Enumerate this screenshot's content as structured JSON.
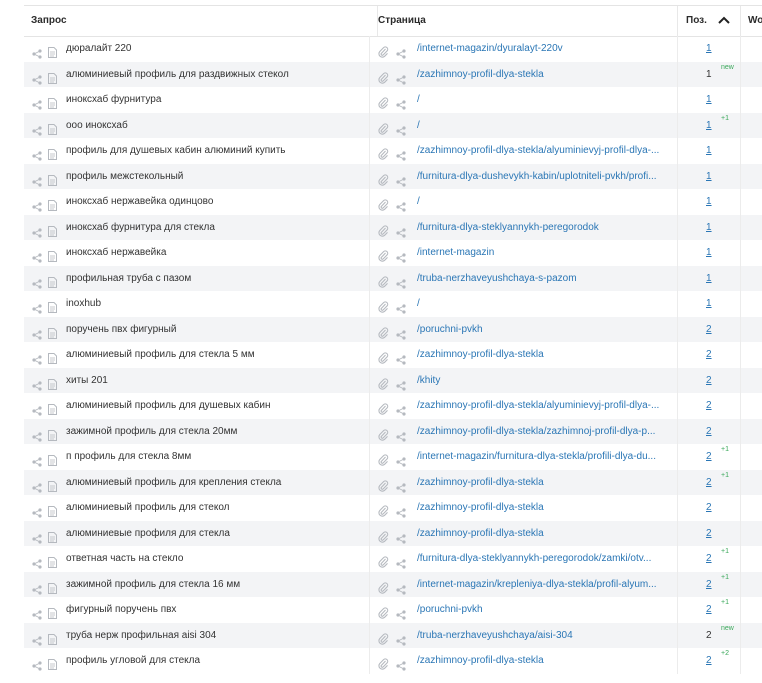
{
  "header": {
    "query": "Запрос",
    "page": "Страница",
    "pos": "Поз.",
    "wo": "Wo"
  },
  "rows": [
    {
      "query": "дюралайт 220",
      "url": "/internet-magazin/dyuralayt-220v",
      "pos": "1",
      "linked": true,
      "badge": ""
    },
    {
      "query": "алюминиевый профиль для раздвижных стекол",
      "url": "/zazhimnoy-profil-dlya-stekla",
      "pos": "1",
      "linked": false,
      "badge": "new"
    },
    {
      "query": "инокcхаб фурнитура",
      "url": "/",
      "pos": "1",
      "linked": true,
      "badge": ""
    },
    {
      "query": "ооо инокcхаб",
      "url": "/",
      "pos": "1",
      "linked": true,
      "badge": "+1"
    },
    {
      "query": "профиль для душевых кабин алюминий купить",
      "url": "/zazhimnoy-profil-dlya-stekla/alyuminievyj-profil-dlya-...",
      "pos": "1",
      "linked": true,
      "badge": ""
    },
    {
      "query": "профиль межстекольный",
      "url": "/furnitura-dlya-dushevykh-kabin/uplotniteli-pvkh/profi...",
      "pos": "1",
      "linked": true,
      "badge": ""
    },
    {
      "query": "инокcхаб нержавейка одинцово",
      "url": "/",
      "pos": "1",
      "linked": true,
      "badge": ""
    },
    {
      "query": "инокcхаб фурнитура для стекла",
      "url": "/furnitura-dlya-steklyannykh-peregorodok",
      "pos": "1",
      "linked": true,
      "badge": ""
    },
    {
      "query": "инокcхаб нержавейка",
      "url": "/internet-magazin",
      "pos": "1",
      "linked": true,
      "badge": ""
    },
    {
      "query": "профильная труба с пазом",
      "url": "/truba-nerzhaveyushchaya-s-pazom",
      "pos": "1",
      "linked": true,
      "badge": ""
    },
    {
      "query": "inoxhub",
      "url": "/",
      "pos": "1",
      "linked": true,
      "badge": ""
    },
    {
      "query": "поручень пвх фигурный",
      "url": "/poruchni-pvkh",
      "pos": "2",
      "linked": true,
      "badge": ""
    },
    {
      "query": "алюминиевый профиль для стекла 5 мм",
      "url": "/zazhimnoy-profil-dlya-stekla",
      "pos": "2",
      "linked": true,
      "badge": ""
    },
    {
      "query": "хиты 201",
      "url": "/khity",
      "pos": "2",
      "linked": true,
      "badge": ""
    },
    {
      "query": "алюминиевый профиль для душевых кабин",
      "url": "/zazhimnoy-profil-dlya-stekla/alyuminievyj-profil-dlya-...",
      "pos": "2",
      "linked": true,
      "badge": ""
    },
    {
      "query": "зажимной профиль для стекла 20мм",
      "url": "/zazhimnoy-profil-dlya-stekla/zazhimnoj-profil-dlya-p...",
      "pos": "2",
      "linked": true,
      "badge": ""
    },
    {
      "query": "п профиль для стекла 8мм",
      "url": "/internet-magazin/furnitura-dlya-stekla/profili-dlya-du...",
      "pos": "2",
      "linked": true,
      "badge": "+1"
    },
    {
      "query": "алюминиевый профиль для крепления стекла",
      "url": "/zazhimnoy-profil-dlya-stekla",
      "pos": "2",
      "linked": true,
      "badge": "+1"
    },
    {
      "query": "алюминиевый профиль для стекол",
      "url": "/zazhimnoy-profil-dlya-stekla",
      "pos": "2",
      "linked": true,
      "badge": ""
    },
    {
      "query": "алюминиевые профиля для стекла",
      "url": "/zazhimnoy-profil-dlya-stekla",
      "pos": "2",
      "linked": true,
      "badge": ""
    },
    {
      "query": "ответная часть на стекло",
      "url": "/furnitura-dlya-steklyannykh-peregorodok/zamki/otv...",
      "pos": "2",
      "linked": true,
      "badge": "+1"
    },
    {
      "query": "зажимной профиль для стекла 16 мм",
      "url": "/internet-magazin/krepleniya-dlya-stekla/profil-alyum...",
      "pos": "2",
      "linked": true,
      "badge": "+1"
    },
    {
      "query": "фигурный поручень пвх",
      "url": "/poruchni-pvkh",
      "pos": "2",
      "linked": true,
      "badge": "+1"
    },
    {
      "query": "труба нерж профильная aisi 304",
      "url": "/truba-nerzhaveyushchaya/aisi-304",
      "pos": "2",
      "linked": false,
      "badge": "new"
    },
    {
      "query": "профиль угловой для стекла",
      "url": "/zazhimnoy-profil-dlya-stekla",
      "pos": "2",
      "linked": true,
      "badge": "+2"
    }
  ],
  "icons": {
    "share": "share-icon",
    "document": "document-icon",
    "attachment": "paperclip-icon",
    "sort": "chevron-up-icon"
  },
  "colors": {
    "link": "#2a76b5",
    "badge": "#3aa85a",
    "stripe": "#f3f4f6"
  }
}
